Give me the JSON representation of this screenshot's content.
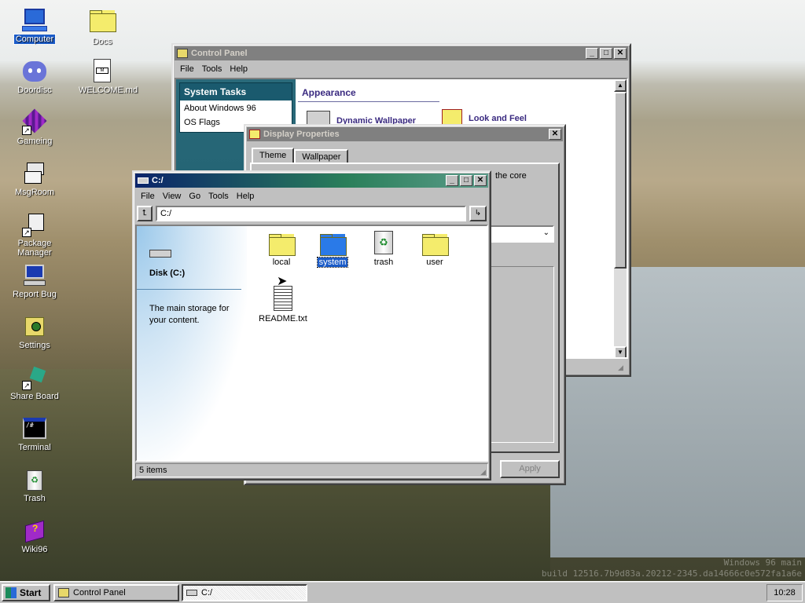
{
  "desktop": {
    "icons": [
      {
        "label": "Computer",
        "icon": "computer-icon"
      },
      {
        "label": "Docs",
        "icon": "folder-icon"
      },
      {
        "label": "Doordisc",
        "icon": "discord-icon"
      },
      {
        "label": "WELCOME.md",
        "icon": "markdown-file-icon"
      },
      {
        "label": "Gameing",
        "icon": "game-cube-icon"
      },
      {
        "label": "MsgRoom",
        "icon": "msgroom-icon"
      },
      {
        "label": "Package Manager",
        "icon": "package-icon"
      },
      {
        "label": "Report Bug",
        "icon": "bug-report-icon"
      },
      {
        "label": "Settings",
        "icon": "settings-icon"
      },
      {
        "label": "Share Board",
        "icon": "shareboard-icon"
      },
      {
        "label": "Terminal",
        "icon": "terminal-icon"
      },
      {
        "label": "Trash",
        "icon": "trash-icon"
      },
      {
        "label": "Wiki96",
        "icon": "wiki-book-icon"
      }
    ],
    "watermark_line1": "Windows 96 main",
    "watermark_line2": "build 12516.7b9d83a.20212-2345.da14666c0e572fa1a6e"
  },
  "control_panel": {
    "title": "Control Panel",
    "menu": [
      "File",
      "Tools",
      "Help"
    ],
    "tasks_header": "System Tasks",
    "tasks": [
      "About Windows 96",
      "OS Flags"
    ],
    "section_title": "Appearance",
    "items": [
      "Dynamic Wallpaper",
      "Look and Feel"
    ]
  },
  "display_properties": {
    "title": "Display Properties",
    "tabs": [
      "Theme",
      "Wallpaper"
    ],
    "body_text": "the core",
    "apply_label": "Apply"
  },
  "explorer": {
    "title": "C:/",
    "menu": [
      "File",
      "View",
      "Go",
      "Tools",
      "Help"
    ],
    "address": "C:/",
    "side_title": "Disk (C:)",
    "side_desc": "The main storage for your content.",
    "files": [
      {
        "name": "local",
        "type": "folder"
      },
      {
        "name": "system",
        "type": "system-folder",
        "selected": true
      },
      {
        "name": "trash",
        "type": "trash"
      },
      {
        "name": "user",
        "type": "folder"
      },
      {
        "name": "README.txt",
        "type": "text-file"
      }
    ],
    "status": "5 items"
  },
  "taskbar": {
    "start_label": "Start",
    "tasks": [
      "Control Panel",
      "C:/"
    ],
    "clock": "10:28"
  },
  "colors": {
    "title_active": "#0a246a",
    "selection": "#1a5bc8",
    "folder_yellow": "#f4ec6c",
    "folder_blue": "#2a7ae8"
  }
}
